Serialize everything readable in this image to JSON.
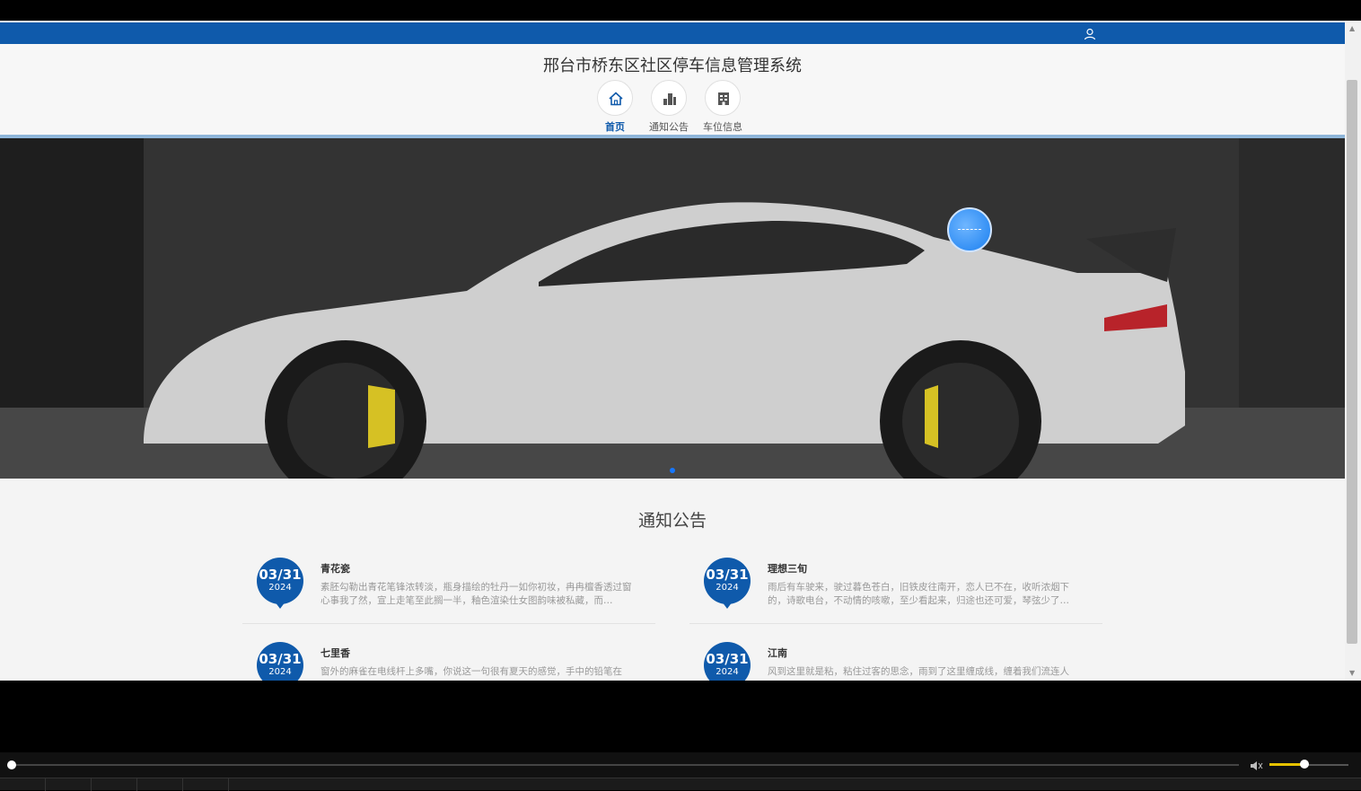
{
  "site": {
    "title": "邢台市桥东区社区停车信息管理系统",
    "accent_color": "#0f5aab",
    "user_icon": "user-icon"
  },
  "nav": {
    "items": [
      {
        "label": "首页",
        "icon": "home-icon",
        "active": true
      },
      {
        "label": "通知公告",
        "icon": "building-icon",
        "active": false
      },
      {
        "label": "车位信息",
        "icon": "list-icon",
        "active": false
      }
    ]
  },
  "hero": {
    "image": "white sports car in garage",
    "carousel_dots": 1
  },
  "notices": {
    "title": "通知公告",
    "items": [
      {
        "month_day": "03/31",
        "year": "2024",
        "title": "青花瓷",
        "body": "素胚勾勒出青花笔锋浓转淡，瓶身描绘的牡丹一如你初妆，冉冉檀香透过窗心事我了然，宣上走笔至此搁一半，釉色渲染仕女图韵味被私藏，而…"
      },
      {
        "month_day": "03/31",
        "year": "2024",
        "title": "理想三旬",
        "body": "雨后有车驶来，驶过暮色苍白，旧铁皮往南开，恋人已不在，收听浓烟下的，诗歌电台，不动情的咳嗽，至少看起来，归途也还可爱，琴弦少了…"
      },
      {
        "month_day": "03/31",
        "year": "2024",
        "title": "七里香",
        "body": "窗外的麻雀在电线杆上多嘴，你说这一句很有夏天的感觉，手中的铅笔在"
      },
      {
        "month_day": "03/31",
        "year": "2024",
        "title": "江南",
        "body": "风到这里就是粘，粘住过客的思念，雨到了这里缠成线，缠着我们流连人"
      }
    ]
  },
  "player": {
    "progress": 0,
    "volume": 0.45
  }
}
